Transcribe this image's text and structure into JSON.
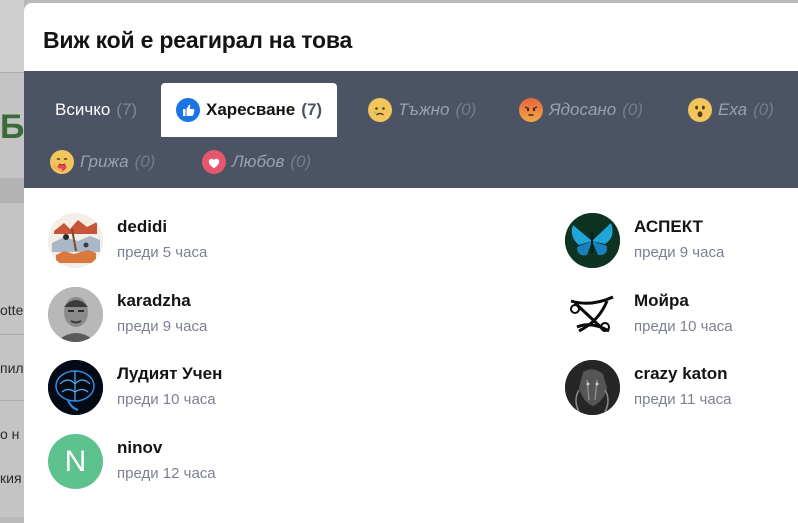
{
  "background": {
    "fragments": [
      "otte",
      "пил",
      "о н",
      "кия"
    ],
    "big_letter": "Б"
  },
  "modal": {
    "title": "Виж кой е реагирал на това"
  },
  "tabs": [
    {
      "label": "Всичко",
      "count": "(7)",
      "icon": "none",
      "active": false,
      "muted": false
    },
    {
      "label": "Харесване",
      "count": "(7)",
      "icon": "like-icon",
      "active": true,
      "muted": false
    },
    {
      "label": "Тъжно",
      "count": "(0)",
      "icon": "sad-emoji-icon",
      "active": false,
      "muted": true
    },
    {
      "label": "Ядосано",
      "count": "(0)",
      "icon": "angry-emoji-icon",
      "active": false,
      "muted": true
    },
    {
      "label": "Еха",
      "count": "(0)",
      "icon": "wow-emoji-icon",
      "active": false,
      "muted": true
    },
    {
      "label": "Грижа",
      "count": "(0)",
      "icon": "care-emoji-icon",
      "active": false,
      "muted": true
    },
    {
      "label": "Любов",
      "count": "(0)",
      "icon": "love-heart-icon",
      "active": false,
      "muted": true
    }
  ],
  "users": [
    {
      "name": "dedidi",
      "time": "преди 5 часа",
      "avatar": "avatar-image"
    },
    {
      "name": "АСПЕКТ",
      "time": "преди 9 часа",
      "avatar": "butterfly-avatar-image"
    },
    {
      "name": "karadzha",
      "time": "преди 9 часа",
      "avatar": "face-photo-avatar"
    },
    {
      "name": "Мойра",
      "time": "преди 10 часа",
      "avatar": "sigil-avatar-image"
    },
    {
      "name": "Лудият Учен",
      "time": "преди 10 часа",
      "avatar": "brain-avatar-image"
    },
    {
      "name": "crazy katon",
      "time": "преди 11 часа",
      "avatar": "dark-avatar-image"
    },
    {
      "name": "ninov",
      "time": "преди 12 часа",
      "avatar": "letter-avatar",
      "avatar_letter": "N",
      "avatar_color": "#5dc28e"
    }
  ],
  "colors": {
    "tab_bar": "#4b5364",
    "like_blue": "#1b74e4",
    "letter_avatar": "#5dc28e"
  }
}
